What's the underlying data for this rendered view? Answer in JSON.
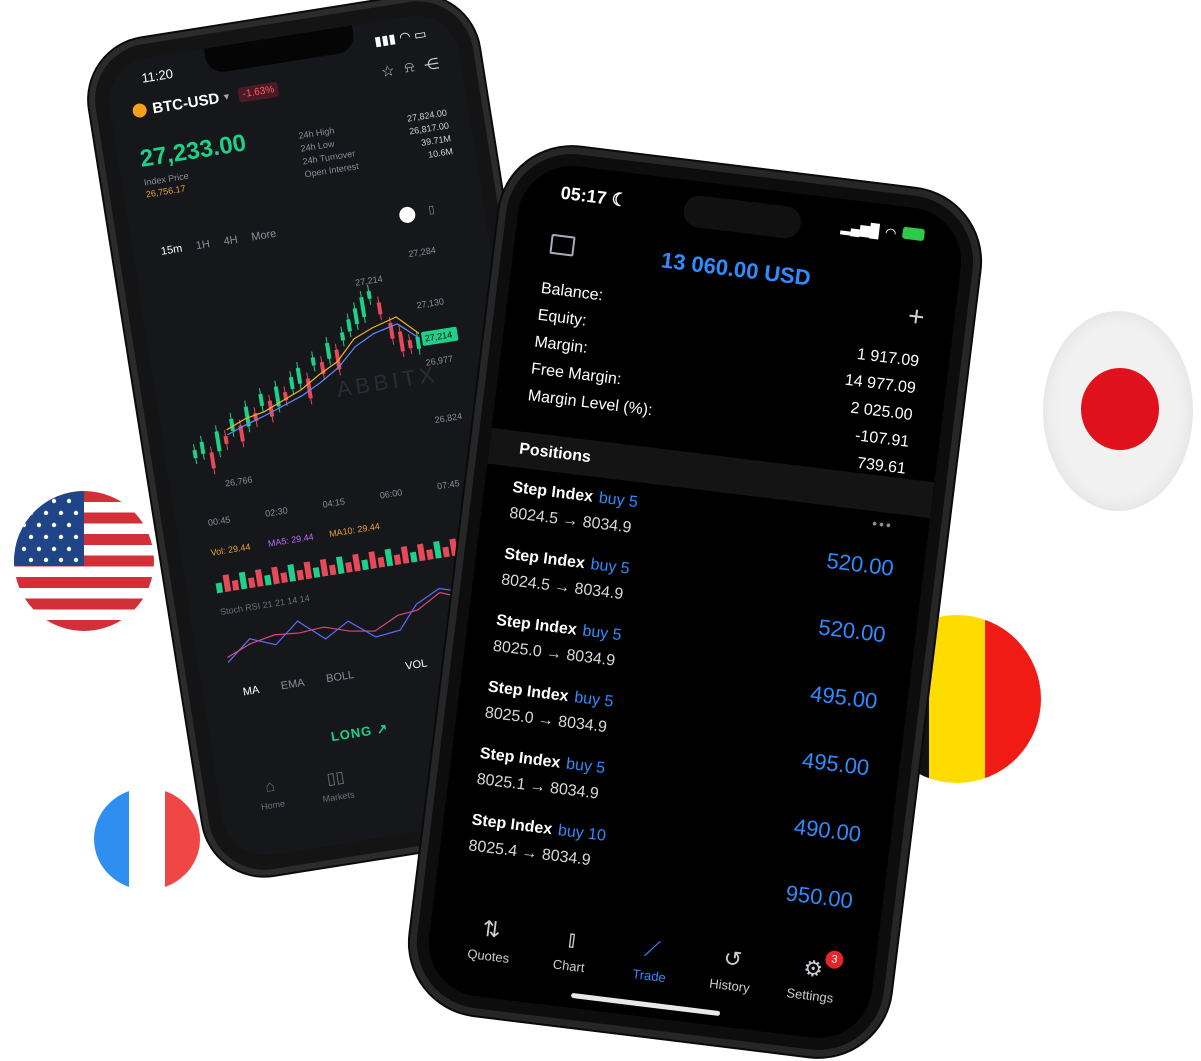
{
  "phone_left": {
    "status_time": "11:20",
    "pair": "BTC-USD",
    "change_badge": "-1.63%",
    "price": "27,233.00",
    "index_label": "Index Price",
    "index_value": "26,756.17",
    "stats": [
      {
        "label": "24h High",
        "value": "27,824.00"
      },
      {
        "label": "24h Low",
        "value": "26,817.00"
      },
      {
        "label": "24h Turnover",
        "value": "39.71M"
      },
      {
        "label": "Open Interest",
        "value": "10.6M"
      }
    ],
    "tabs": [
      "15m",
      "1H",
      "4H",
      "More"
    ],
    "price_marks": [
      "27,284",
      "27,214",
      "27,130",
      "27,214",
      "26,977",
      "26,824",
      "26,766"
    ],
    "time_marks": [
      "00:45",
      "02:30",
      "04:15",
      "06:00",
      "07:45"
    ],
    "watermark": "ABBITX",
    "volume_legend": {
      "vol": "Vol: 29.44",
      "ma5": "MA5: 29.44",
      "ma10": "MA10: 29.44"
    },
    "stoch_label": "Stoch RSI 21 21 14 14",
    "indicator_tabs": [
      "MA",
      "EMA",
      "BOLL",
      "VOL"
    ],
    "long_label": "LONG ↗",
    "nav": [
      {
        "label": "Home",
        "icon": "home-icon"
      },
      {
        "label": "Markets",
        "icon": "markets-icon"
      }
    ]
  },
  "phone_right": {
    "status_time": "05:17",
    "balance_title": "13 060.00 USD",
    "summary_labels": [
      "Balance:",
      "Equity:",
      "Margin:",
      "Free Margin:",
      "Margin Level (%):"
    ],
    "summary_values": [
      "1 917.09",
      "14 977.09",
      "2 025.00",
      "-107.91",
      "739.61"
    ],
    "positions_header": "Positions",
    "positions": [
      {
        "name": "Step Index",
        "side": "buy 5",
        "prices": "8024.5 → 8034.9",
        "amount": "520.00"
      },
      {
        "name": "Step Index",
        "side": "buy 5",
        "prices": "8024.5 → 8034.9",
        "amount": "520.00"
      },
      {
        "name": "Step Index",
        "side": "buy 5",
        "prices": "8025.0 → 8034.9",
        "amount": "495.00"
      },
      {
        "name": "Step Index",
        "side": "buy 5",
        "prices": "8025.0 → 8034.9",
        "amount": "495.00"
      },
      {
        "name": "Step Index",
        "side": "buy 5",
        "prices": "8025.1 → 8034.9",
        "amount": "490.00"
      },
      {
        "name": "Step Index",
        "side": "buy 10",
        "prices": "8025.4 → 8034.9",
        "amount": "950.00"
      }
    ],
    "nav": [
      {
        "label": "Quotes",
        "icon": "quotes-icon"
      },
      {
        "label": "Chart",
        "icon": "chart-icon"
      },
      {
        "label": "Trade",
        "icon": "trade-icon"
      },
      {
        "label": "History",
        "icon": "history-icon"
      },
      {
        "label": "Settings",
        "icon": "settings-icon",
        "badge": "3"
      }
    ]
  },
  "colors": {
    "accent_blue": "#2f8bff",
    "up_green": "#1fd08a",
    "down_red": "#e64a5a"
  }
}
